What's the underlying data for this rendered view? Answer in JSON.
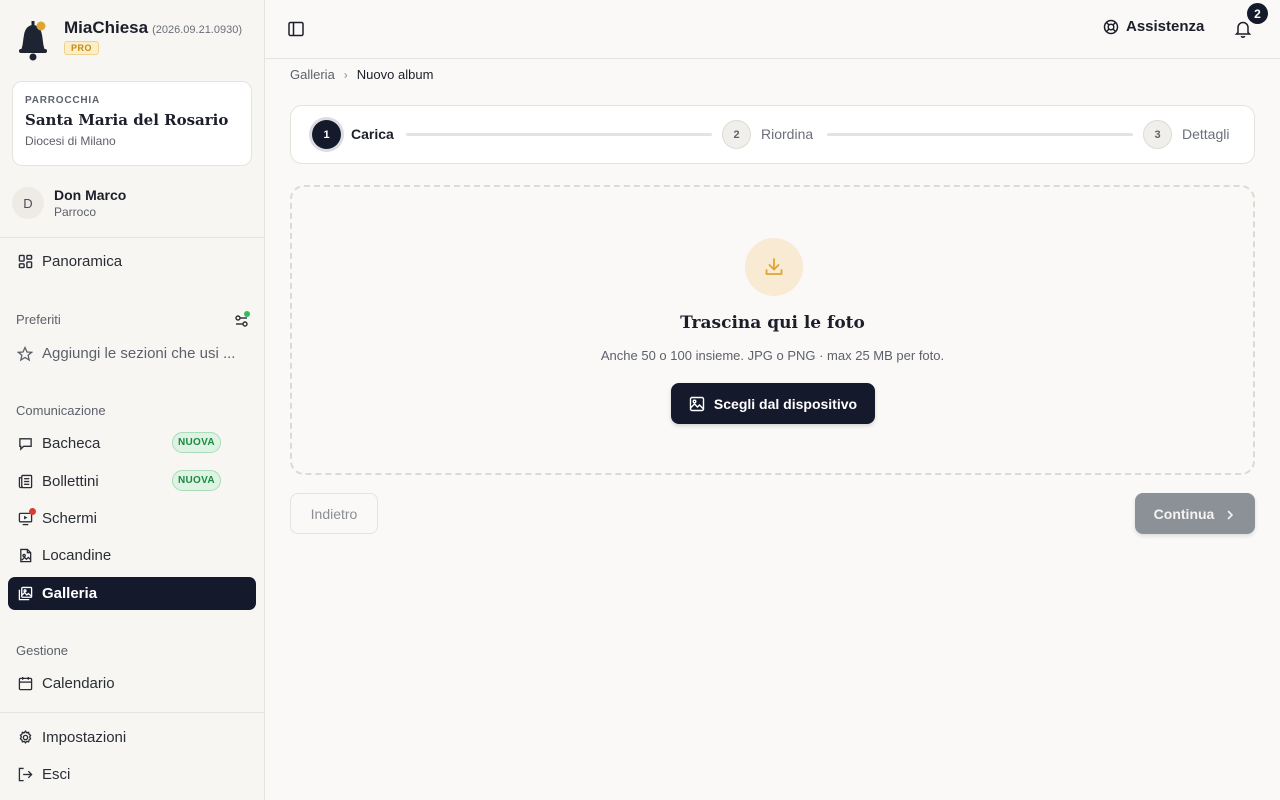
{
  "brand": {
    "name": "MiaChiesa",
    "version": "(2026.09.21.0930)",
    "plan_badge": "PRO",
    "logo_icon": "bell-icon"
  },
  "parish": {
    "label": "PARROCCHIA",
    "name": "Santa Maria del Rosario",
    "diocese": "Diocesi di Milano"
  },
  "user": {
    "initial": "D",
    "name": "Don Marco",
    "role": "Parroco"
  },
  "sidebar": {
    "overview": {
      "label": "Panoramica",
      "icon": "grid-icon"
    },
    "favorites": {
      "title": "Preferiti",
      "hint": "Aggiungi le sezioni che usi ...",
      "hint_icon": "star-icon",
      "toggle_icon": "sliders-icon"
    },
    "communication": {
      "title": "Comunicazione",
      "items": [
        {
          "label": "Bacheca",
          "icon": "message-icon",
          "badge": "NUOVA"
        },
        {
          "label": "Bollettini",
          "icon": "newspaper-icon",
          "badge": "NUOVA"
        },
        {
          "label": "Schermi",
          "icon": "monitor-icon",
          "badge": ""
        },
        {
          "label": "Locandine",
          "icon": "file-image-icon",
          "badge": ""
        },
        {
          "label": "Galleria",
          "icon": "images-icon",
          "badge": "",
          "active": true
        }
      ]
    },
    "management": {
      "title": "Gestione",
      "items": [
        {
          "label": "Calendario",
          "icon": "calendar-icon"
        }
      ]
    },
    "footer": [
      {
        "label": "Impostazioni",
        "icon": "gear-icon"
      },
      {
        "label": "Esci",
        "icon": "logout-icon"
      }
    ]
  },
  "topbar": {
    "toggle_icon": "sidebar-toggle-icon",
    "help_label": "Assistenza",
    "help_icon": "lifebuoy-icon",
    "notifications_count": "2",
    "bell_icon": "bell-icon"
  },
  "breadcrumb": {
    "parent": "Galleria",
    "current": "Nuovo album",
    "separator": "›"
  },
  "stepper": {
    "steps": [
      {
        "number": "1",
        "label": "Carica",
        "state": "active"
      },
      {
        "number": "2",
        "label": "Riordina",
        "state": "pending"
      },
      {
        "number": "3",
        "label": "Dettagli",
        "state": "pending"
      }
    ]
  },
  "dropzone": {
    "icon": "download-icon",
    "title": "Trascina qui le foto",
    "subtitle": "Anche 50 o 100 insieme. JPG o PNG · max 25 MB per foto.",
    "button_label": "Scegli dal dispositivo",
    "button_icon": "image-icon"
  },
  "actions": {
    "back_label": "Indietro",
    "next_label": "Continua",
    "next_icon": "chevron-right-icon"
  },
  "colors": {
    "accent_dark": "#141a2b",
    "gold": "#e0a52e",
    "new_badge_green": "#1a8a3e",
    "alert_red": "#e03b2f"
  }
}
